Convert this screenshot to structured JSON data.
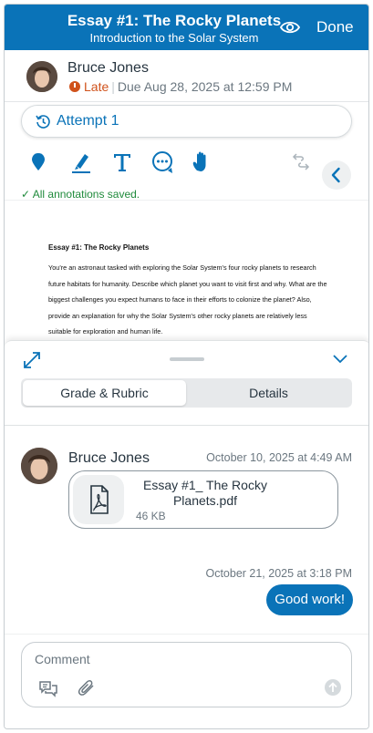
{
  "header": {
    "title": "Essay #1: The Rocky Planets",
    "subtitle": "Introduction to the Solar System",
    "done_label": "Done",
    "icons": [
      "eye-icon"
    ]
  },
  "student": {
    "name": "Bruce Jones",
    "status": "Late",
    "due": "Due Aug 28, 2025 at 12:59 PM"
  },
  "attempt": {
    "label": "Attempt 1"
  },
  "toolbar": {
    "tools": [
      "pin-icon",
      "highlighter-icon",
      "text-icon",
      "comment-icon",
      "hand-icon",
      "undo-redo-icon",
      "collapse-icon"
    ],
    "saved_text": "All annotations saved."
  },
  "document": {
    "title": "Essay #1: The Rocky Planets",
    "body": "You're an astronaut tasked with exploring the Solar System's four rocky planets to research future habitats for humanity. Describe which planet you want to visit first and why. What are the biggest challenges you expect humans to face in their efforts to colonize the planet? Also, provide an explanation for why the Solar System's other rocky planets are relatively less suitable for exploration and human life."
  },
  "sheet": {
    "tabs": [
      "Grade & Rubric",
      "Details"
    ],
    "active_tab": "Grade & Rubric"
  },
  "messages": [
    {
      "author": "Bruce Jones",
      "time": "October 10, 2025 at 4:49 AM",
      "attachment": {
        "name": "Essay #1_ The Rocky Planets.pdf",
        "size": "46 KB"
      }
    },
    {
      "time": "October 21, 2025 at 3:18 PM",
      "text": "Good work!"
    }
  ],
  "composer": {
    "placeholder": "Comment"
  },
  "colors": {
    "brand": "#0a73b8",
    "late": "#d0521b",
    "saved": "#1f8a3b"
  }
}
